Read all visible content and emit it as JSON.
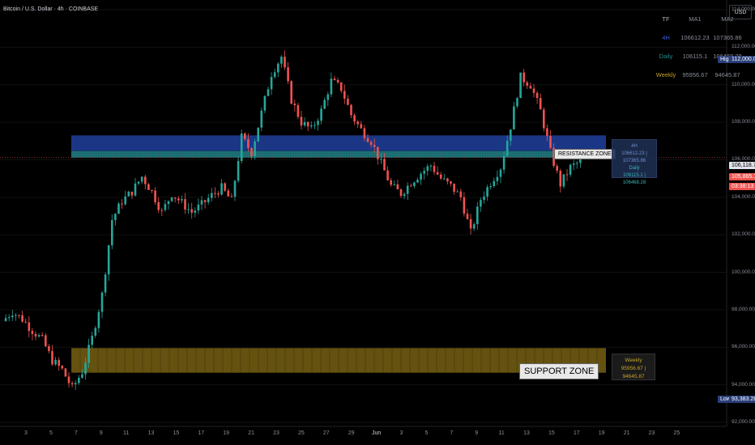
{
  "header": {
    "title": "Bitcoin / U.S. Dollar · 4h · COINBASE",
    "currency_button": "USD"
  },
  "ma_table": {
    "headers": [
      "TF",
      "MA1",
      "MA2"
    ],
    "rows": [
      {
        "tf": "4H",
        "ma1": "106612.23",
        "ma2": "107365.86",
        "color": "#3d5ccc"
      },
      {
        "tf": "Daily",
        "ma1": "106115.1",
        "ma2": "106468.28",
        "color": "#1f8f93"
      },
      {
        "tf": "Weekly",
        "ma1": "95956.67",
        "ma2": "94645.87",
        "color": "#c9a227"
      }
    ]
  },
  "zones": {
    "resistance_label": "RESISTANCE ZONE",
    "support_label": "SUPPORT ZONE",
    "box_4h_title": "4H",
    "box_4h_values": "106612.23 | 107365.86",
    "box_daily_title": "Daily",
    "box_daily_values": "106115.1 | 106468.28",
    "box_weekly_title": "Weekly",
    "box_weekly_values": "95956.67 | 94645.87"
  },
  "price_tags": {
    "high_label": "High",
    "high_value": "112,000.00",
    "current_value": "106,118.70",
    "last_value": "105,865.11",
    "countdown": "03:38:13",
    "low_label": "Low",
    "low_value": "93,383.28"
  },
  "axis": {
    "y_labels": [
      "114,000.00",
      "112,000.00",
      "110,000.00",
      "108,000.00",
      "106,000.00",
      "104,000.00",
      "102,000.00",
      "100,000.00",
      "98,000.00",
      "96,000.00",
      "94,000.00",
      "92,000.00"
    ],
    "x_labels": [
      "3",
      "5",
      "7",
      "9",
      "11",
      "13",
      "15",
      "17",
      "19",
      "21",
      "23",
      "25",
      "27",
      "29",
      "Jun",
      "3",
      "5",
      "7",
      "9",
      "11",
      "13",
      "15",
      "17",
      "19",
      "21",
      "23",
      "25"
    ]
  },
  "colors": {
    "up": "#26a69a",
    "down": "#ef5350",
    "resistance_4h": "#1e3f9c",
    "resistance_daily": "#1f7a7f",
    "support": "#b8961e"
  },
  "chart_data": {
    "type": "candlestick",
    "timeframe": "4h",
    "symbol": "BTCUSD",
    "ylim": [
      92000,
      114000
    ],
    "resistance_zone": [
      106115.1,
      107365.86
    ],
    "support_zone": [
      94645.87,
      95956.67
    ],
    "current_price": 106118.7,
    "high": 112000.0,
    "low": 93383.28,
    "close_path": [
      [
        0,
        97400
      ],
      [
        3,
        97900
      ],
      [
        6,
        97500
      ],
      [
        9,
        96900
      ],
      [
        12,
        96400
      ],
      [
        15,
        95300
      ],
      [
        18,
        94800
      ],
      [
        21,
        93800
      ],
      [
        24,
        94700
      ],
      [
        27,
        96500
      ],
      [
        30,
        98800
      ],
      [
        33,
        102800
      ],
      [
        36,
        103800
      ],
      [
        39,
        104300
      ],
      [
        42,
        105100
      ],
      [
        45,
        104300
      ],
      [
        48,
        103200
      ],
      [
        51,
        104200
      ],
      [
        54,
        103700
      ],
      [
        57,
        103200
      ],
      [
        60,
        103600
      ],
      [
        63,
        104100
      ],
      [
        66,
        104500
      ],
      [
        69,
        103800
      ],
      [
        72,
        107200
      ],
      [
        75,
        106400
      ],
      [
        78,
        108500
      ],
      [
        81,
        110600
      ],
      [
        84,
        111500
      ],
      [
        87,
        109200
      ],
      [
        90,
        108000
      ],
      [
        93,
        107600
      ],
      [
        96,
        108600
      ],
      [
        99,
        110200
      ],
      [
        102,
        109800
      ],
      [
        105,
        108400
      ],
      [
        108,
        107600
      ],
      [
        111,
        107000
      ],
      [
        114,
        105800
      ],
      [
        117,
        104600
      ],
      [
        120,
        104200
      ],
      [
        123,
        104800
      ],
      [
        126,
        105300
      ],
      [
        129,
        105700
      ],
      [
        132,
        105000
      ],
      [
        135,
        104600
      ],
      [
        138,
        104000
      ],
      [
        141,
        102100
      ],
      [
        144,
        103900
      ],
      [
        147,
        104800
      ],
      [
        150,
        105600
      ],
      [
        153,
        107800
      ],
      [
        156,
        110400
      ],
      [
        159,
        110000
      ],
      [
        162,
        108600
      ],
      [
        165,
        106400
      ],
      [
        168,
        104700
      ],
      [
        171,
        105600
      ],
      [
        174,
        105900
      ]
    ]
  }
}
